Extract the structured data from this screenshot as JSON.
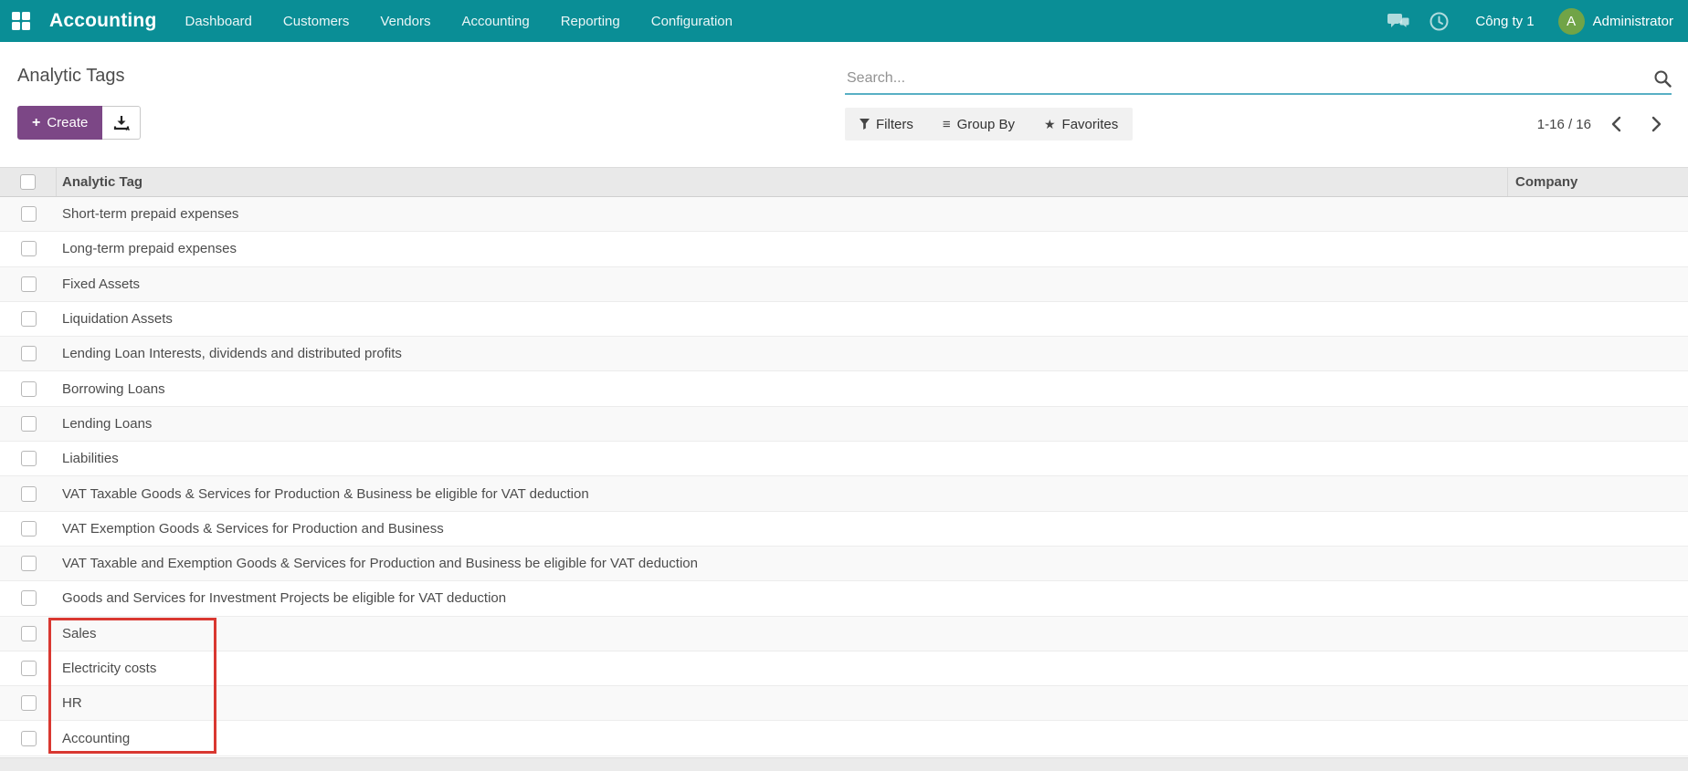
{
  "navbar": {
    "brand": "Accounting",
    "menu_items": [
      "Dashboard",
      "Customers",
      "Vendors",
      "Accounting",
      "Reporting",
      "Configuration"
    ],
    "company": "Công ty 1",
    "user_initial": "A",
    "user_name": "Administrator"
  },
  "control_panel": {
    "title": "Analytic Tags",
    "create_label": "Create",
    "plus_glyph": "+",
    "search_placeholder": "Search...",
    "filters_label": "Filters",
    "group_by_label": "Group By",
    "group_by_glyph": "≡",
    "favorites_label": "Favorites",
    "favorites_glyph": "★",
    "pager_value": "1-16 / 16"
  },
  "table": {
    "columns": [
      "Analytic Tag",
      "Company"
    ],
    "rows": [
      "Short-term prepaid expenses",
      "Long-term prepaid expenses",
      "Fixed Assets",
      "Liquidation Assets",
      "Lending Loan Interests, dividends and distributed profits",
      "Borrowing Loans",
      "Lending Loans",
      "Liabilities",
      "VAT Taxable Goods & Services for Production & Business be eligible for VAT deduction",
      "VAT Exemption Goods & Services for Production and Business",
      "VAT Taxable and Exemption Goods & Services for Production and Business be eligible for VAT deduction",
      "Goods and Services for Investment Projects be eligible for VAT deduction",
      "Sales",
      "Electricity costs",
      "HR",
      "Accounting"
    ]
  },
  "annotation": {
    "highlighted_rows": [
      "Sales",
      "Electricity costs",
      "HR",
      "Accounting"
    ],
    "color": "#d93831"
  },
  "colors": {
    "navbar_bg": "#0a8e96",
    "primary_button": "#7c4786",
    "avatar_bg": "#71a447",
    "search_underline": "#58afc4",
    "annotation_red": "#d93831",
    "header_bg": "#e9e9e9",
    "row_stripe": "#f9f9f9",
    "text_main": "#4c4c4c"
  }
}
